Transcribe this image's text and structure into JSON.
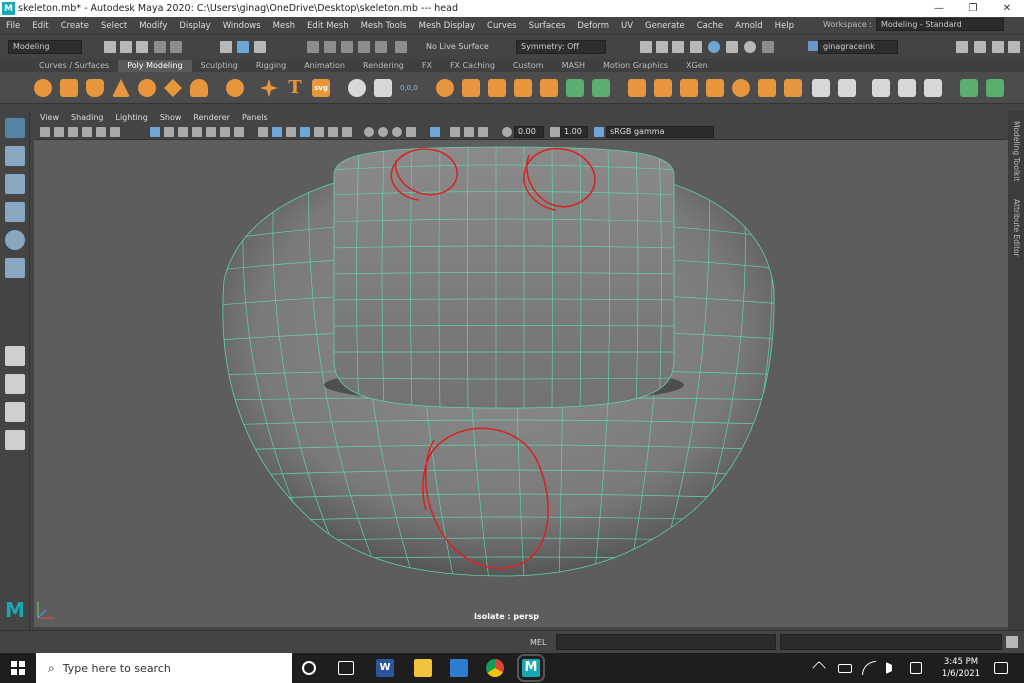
{
  "window": {
    "title": "skeleton.mb* - Autodesk Maya 2020: C:\\Users\\ginag\\OneDrive\\Desktop\\skeleton.mb   ---   head",
    "logo_letter": "M",
    "minimize": "—",
    "restore": "❐",
    "close": "✕"
  },
  "menus": [
    "File",
    "Edit",
    "Create",
    "Select",
    "Modify",
    "Display",
    "Windows",
    "Mesh",
    "Edit Mesh",
    "Mesh Tools",
    "Mesh Display",
    "Curves",
    "Surfaces",
    "Deform",
    "UV",
    "Generate",
    "Cache",
    "Arnold",
    "Help"
  ],
  "workspace": {
    "label": "Workspace :",
    "value": "Modeling - Standard"
  },
  "statusline": {
    "menuset": "Modeling",
    "live_surface": "No Live Surface",
    "symmetry": "Symmetry: Off",
    "user": "ginagraceink"
  },
  "shelf_tabs": [
    "Curves / Surfaces",
    "Poly Modeling",
    "Sculpting",
    "Rigging",
    "Animation",
    "Rendering",
    "FX",
    "FX Caching",
    "Custom",
    "MASH",
    "Motion Graphics",
    "XGen"
  ],
  "shelf_active_tab": "Poly Modeling",
  "shelf_text_icons": {
    "text_tool": "T",
    "svg_tool": "svg",
    "coords": "0,0,0"
  },
  "panel_menus": [
    "View",
    "Shading",
    "Lighting",
    "Show",
    "Renderer",
    "Panels"
  ],
  "panel_toolbar": {
    "exposure": "0.00",
    "gamma": "1.00",
    "color_space": "sRGB gamma"
  },
  "viewport": {
    "hud_label": "Isolate : persp"
  },
  "right_panel": {
    "modeling_toolkit": "Modeling Toolkit",
    "attribute_editor": "Attribute Editor"
  },
  "command_line": {
    "label": "MEL"
  },
  "taskbar": {
    "search_placeholder": "Type here to search",
    "time": "3:45 PM",
    "date": "1/6/2021",
    "maya_letter": "M",
    "word_letter": "W"
  },
  "colors": {
    "mesh_wire": "#5fd3a6",
    "annotation_red": "#d42626",
    "maya_teal": "#18a8b4",
    "shelf_orange": "#e7963e"
  }
}
